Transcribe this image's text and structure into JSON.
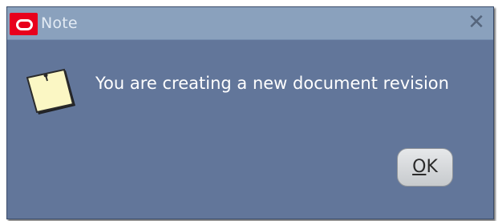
{
  "window": {
    "title": "Note",
    "close_glyph": "✕"
  },
  "dialog": {
    "icon": "note-icon",
    "message": "You are creating a new document revision"
  },
  "buttons": {
    "ok_mnemonic": "O",
    "ok_rest": "K"
  },
  "colors": {
    "dialog_background": "#62769a",
    "titlebar_background": "#8aa1bd",
    "logo_red": "#e8001c",
    "note_paper": "#fbf7c4"
  }
}
